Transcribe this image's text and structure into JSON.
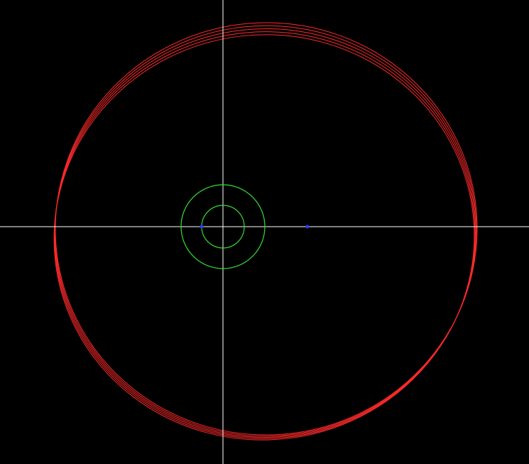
{
  "colors": {
    "background": "#000000",
    "axes": "#ffffff",
    "orbit": "#ff2a2a",
    "rings": "#33dd33",
    "points": "#2b3cff"
  },
  "diagram": {
    "axes_visible": true,
    "orbit_loops_visible": 5,
    "inner_ring_count": 2,
    "marked_points": 2
  }
}
